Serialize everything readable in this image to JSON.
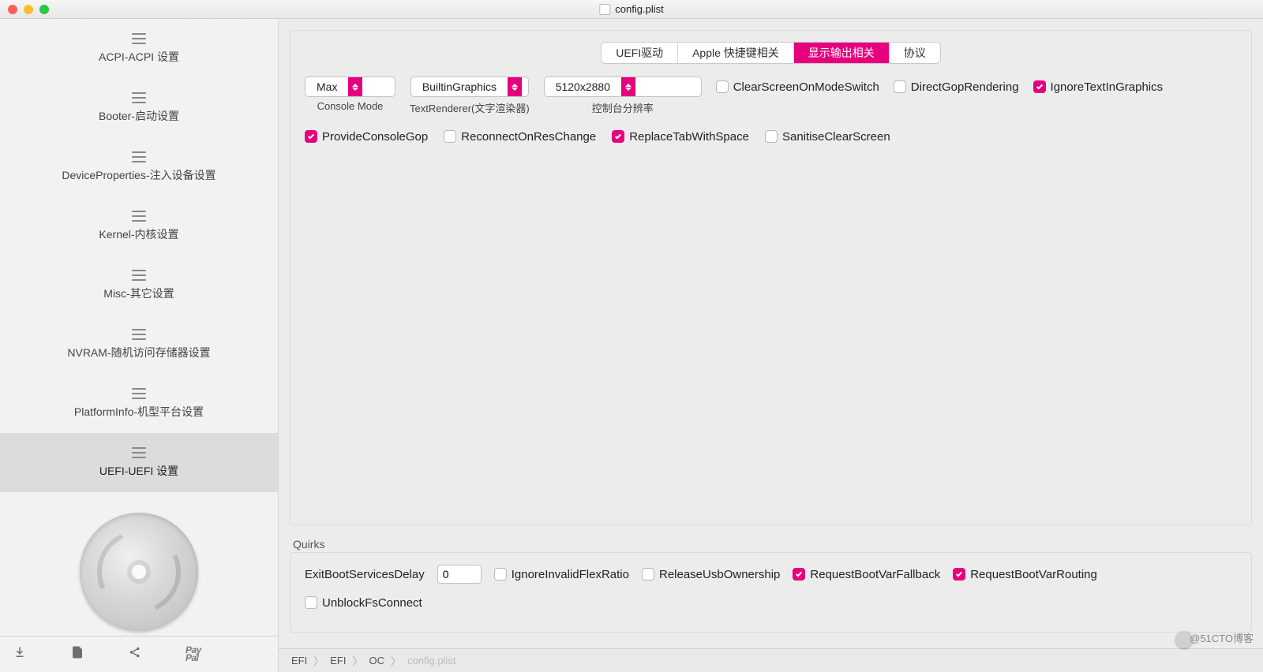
{
  "title": "config.plist",
  "sidebar": {
    "items": [
      {
        "label": "ACPI-ACPI 设置"
      },
      {
        "label": "Booter-启动设置"
      },
      {
        "label": "DeviceProperties-注入设备设置"
      },
      {
        "label": "Kernel-内核设置"
      },
      {
        "label": "Misc-其它设置"
      },
      {
        "label": "NVRAM-随机访问存储器设置"
      },
      {
        "label": "PlatformInfo-机型平台设置"
      },
      {
        "label": "UEFI-UEFI 设置"
      }
    ]
  },
  "tabs": [
    "UEFI驱动",
    "Apple 快捷键相关",
    "显示输出相关",
    "协议"
  ],
  "active_tab": 2,
  "selects": {
    "console_mode": {
      "value": "Max",
      "label": "Console Mode"
    },
    "text_renderer": {
      "value": "BuiltinGraphics",
      "label": "TextRenderer(文字渲染器)"
    },
    "resolution": {
      "value": "5120x2880",
      "label": "控制台分辨率"
    }
  },
  "checkboxes_row1": [
    {
      "label": "ClearScreenOnModeSwitch",
      "checked": false
    },
    {
      "label": "DirectGopRendering",
      "checked": false
    },
    {
      "label": "IgnoreTextInGraphics",
      "checked": true
    }
  ],
  "checkboxes_row2": [
    {
      "label": "ProvideConsoleGop",
      "checked": true
    },
    {
      "label": "ReconnectOnResChange",
      "checked": false
    },
    {
      "label": "ReplaceTabWithSpace",
      "checked": true
    },
    {
      "label": "SanitiseClearScreen",
      "checked": false
    }
  ],
  "quirks_label": "Quirks",
  "quirks": {
    "exit_delay_label": "ExitBootServicesDelay",
    "exit_delay_value": "0",
    "row1": [
      {
        "label": "IgnoreInvalidFlexRatio",
        "checked": false
      },
      {
        "label": "ReleaseUsbOwnership",
        "checked": false
      },
      {
        "label": "RequestBootVarFallback",
        "checked": true
      },
      {
        "label": "RequestBootVarRouting",
        "checked": true
      }
    ],
    "row2": [
      {
        "label": "UnblockFsConnect",
        "checked": false
      }
    ]
  },
  "breadcrumb": [
    "EFI",
    "EFI",
    "OC",
    "config.plist"
  ],
  "watermark": "@51CTO博客",
  "paypal": "Pay\nPal"
}
